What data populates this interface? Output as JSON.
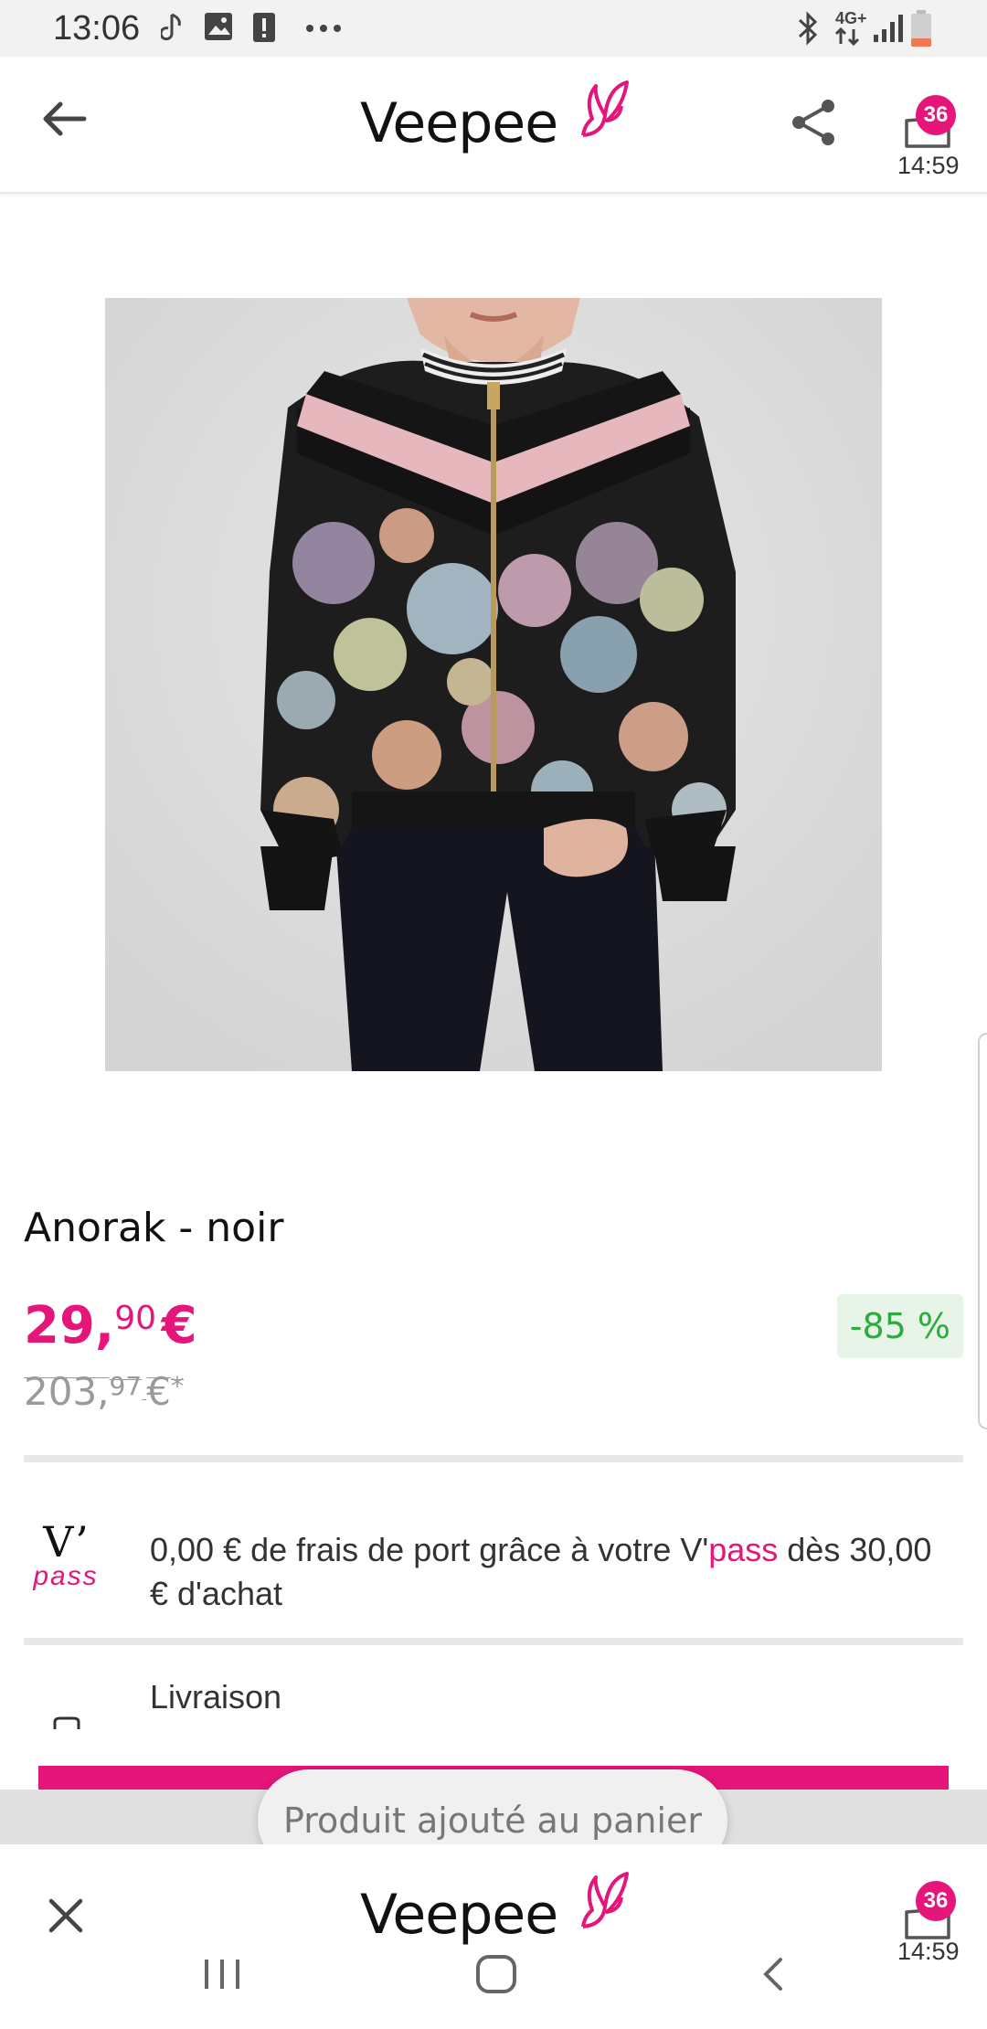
{
  "status_bar": {
    "time": "13:06",
    "left_icons": [
      "music-note-icon",
      "image-icon",
      "alert-icon",
      "more-dots-icon"
    ],
    "right_icons": [
      "bluetooth-icon",
      "4g-icon",
      "signal-icon",
      "battery-icon"
    ],
    "network": "4G+"
  },
  "header": {
    "brand": "Veepee",
    "cart_count": "36",
    "cart_timer": "14:59"
  },
  "product": {
    "title": "Anorak - noir",
    "price_int": "29,",
    "price_dec": "90",
    "price_cur": "€",
    "old_price_int": "203,",
    "old_price_dec": "97",
    "old_price_cur": "€",
    "old_price_mark": "*",
    "discount": "-85 %"
  },
  "vpass": {
    "logo_v": "V’",
    "logo_word": "pass",
    "text_before": "0,00 € de frais de port grâce à votre V'",
    "text_pink": "pass",
    "text_after": " dès 30,00 € d'achat"
  },
  "delivery": {
    "label": "Livraison"
  },
  "toast": {
    "message": "Produit ajouté au panier"
  },
  "bottom_header": {
    "brand": "Veepee",
    "cart_count": "36",
    "cart_timer": "14:59"
  },
  "colors": {
    "brand_pink": "#e5157a",
    "discount_green": "#2eaa3e",
    "discount_bg": "#e6f5e8"
  }
}
